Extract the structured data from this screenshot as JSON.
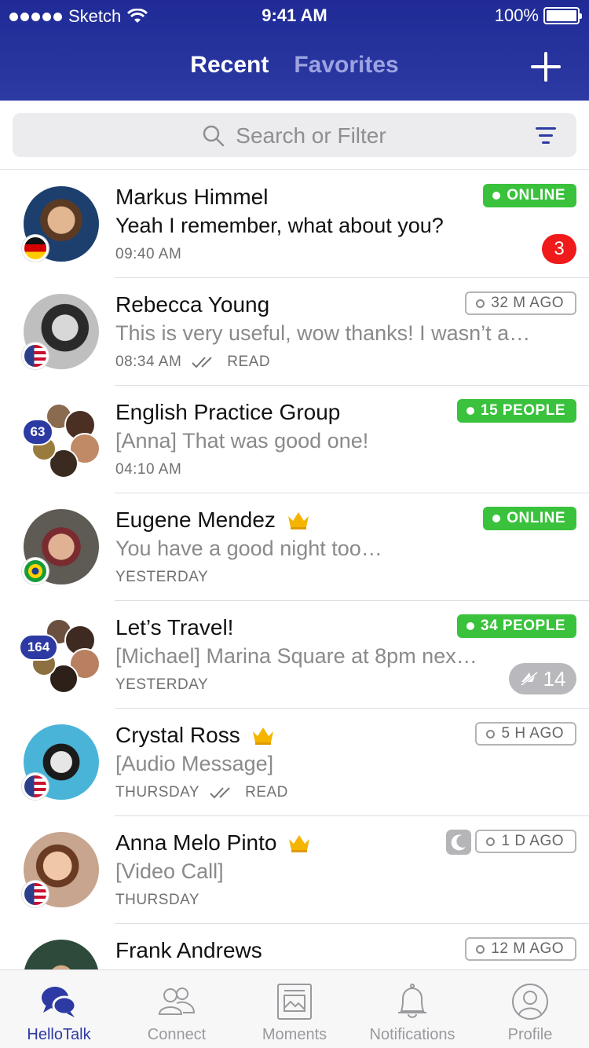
{
  "status_bar": {
    "carrier": "Sketch",
    "time": "9:41 AM",
    "battery": "100%"
  },
  "header": {
    "tab_recent": "Recent",
    "tab_favorites": "Favorites"
  },
  "search": {
    "placeholder": "Search or Filter"
  },
  "chats": [
    {
      "name": "Markus Himmel",
      "message": "Yeah I remember, what about you?",
      "time": "09:40 AM",
      "status": "ONLINE",
      "unread": "3",
      "flag": "germany-flag"
    },
    {
      "name": "Rebecca Young",
      "message": "This is very useful, wow thanks! I wasn’t a…",
      "time": "08:34 AM",
      "read": "READ",
      "status": "32 M AGO",
      "flag": "usa-flag"
    },
    {
      "name": "English Practice Group",
      "message": "[Anna] That was good one!",
      "time": "04:10 AM",
      "status": "15 PEOPLE",
      "members": "63"
    },
    {
      "name": "Eugene Mendez",
      "message": "You have a good night too…",
      "time": "YESTERDAY",
      "status": "ONLINE",
      "flag": "brazil-flag",
      "vip": "crown-icon"
    },
    {
      "name": "Let’s Travel!",
      "message": "[Michael] Marina Square at 8pm nex…",
      "time": "YESTERDAY",
      "status": "34 PEOPLE",
      "members": "164",
      "muted_count": "14"
    },
    {
      "name": "Crystal Ross",
      "message": "[Audio Message]",
      "time": "THURSDAY",
      "read": "READ",
      "status": "5 H AGO",
      "flag": "usa-flag",
      "vip": "crown-icon"
    },
    {
      "name": "Anna Melo Pinto",
      "message": "[Video Call]",
      "time": "THURSDAY",
      "status": "1 D AGO",
      "flag": "usa-flag",
      "vip": "crown-icon",
      "sleep": "moon-icon"
    },
    {
      "name": "Frank Andrews",
      "status": "12 M AGO"
    }
  ],
  "tabbar": {
    "hellotalk": "HelloTalk",
    "connect": "Connect",
    "moments": "Moments",
    "notifications": "Notifications",
    "profile": "Profile"
  },
  "colors": {
    "brand": "#2d3aa3",
    "online": "#3ac23c",
    "unread": "#f01a1a"
  }
}
